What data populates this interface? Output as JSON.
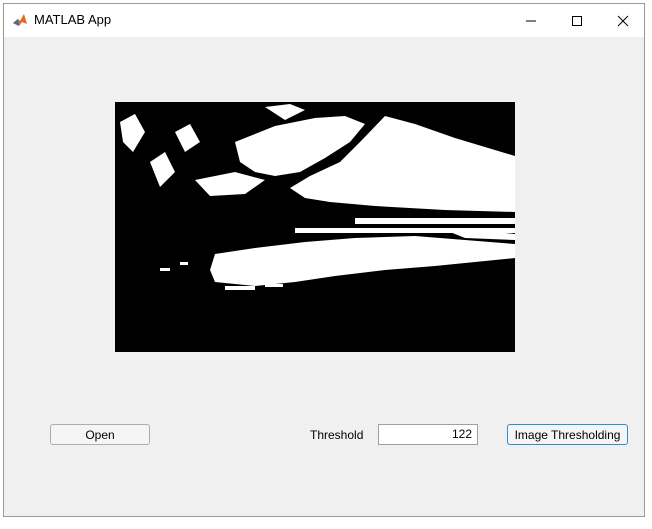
{
  "window": {
    "title": "MATLAB App",
    "icon": "matlab-icon"
  },
  "controls": {
    "open_label": "Open",
    "threshold_label": "Threshold",
    "threshold_value": "122",
    "threshold_button_label": "Image Thresholding"
  },
  "image": {
    "description_icon": "thresholded-image",
    "foreground": "#ffffff",
    "background": "#000000"
  },
  "colors": {
    "window_bg": "#f0f0f0",
    "accent": "#2b8fd6"
  }
}
